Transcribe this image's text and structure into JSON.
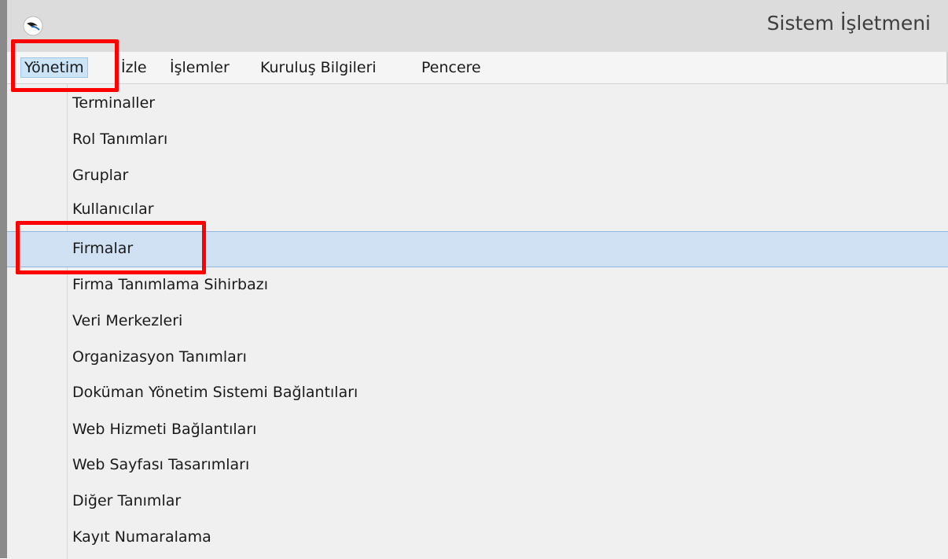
{
  "window": {
    "title": "Sistem İşletmeni",
    "app_icon": "swoosh-icon"
  },
  "menubar": {
    "items": [
      "Yönetim",
      "İzle",
      "İşlemler",
      "Kuruluş Bilgileri",
      "Pencere"
    ],
    "active": "Yönetim"
  },
  "dropdown": {
    "items": [
      "Terminaller",
      "Rol Tanımları",
      "Gruplar",
      "Kullanıcılar",
      "Firmalar",
      "Firma Tanımlama Sihirbazı",
      "Veri Merkezleri",
      "Organizasyon Tanımları",
      "Doküman Yönetim Sistemi Bağlantıları",
      "Web Hizmeti Bağlantıları",
      "Web Sayfası Tasarımları",
      "Diğer Tanımlar",
      "Kayıt Numaralama"
    ],
    "selected": "Firmalar"
  },
  "colors": {
    "highlight_box": "#ff0000",
    "selection_bg": "#cfe1f2"
  }
}
